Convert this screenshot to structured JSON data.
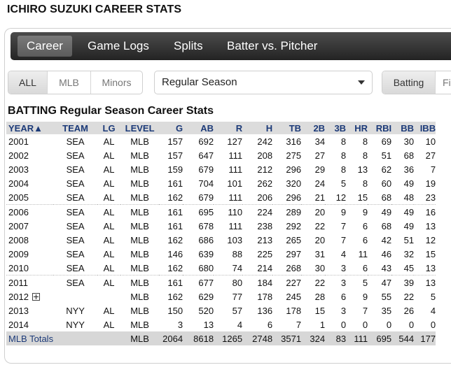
{
  "page": {
    "title": "ICHIRO SUZUKI CAREER STATS"
  },
  "nav": {
    "tabs": [
      {
        "label": "Career",
        "active": true
      },
      {
        "label": "Game Logs",
        "active": false
      },
      {
        "label": "Splits",
        "active": false
      },
      {
        "label": "Batter vs. Pitcher",
        "active": false
      }
    ]
  },
  "filters": {
    "league_options": [
      {
        "label": "ALL",
        "active": true
      },
      {
        "label": "MLB",
        "active": false
      },
      {
        "label": "Minors",
        "active": false
      }
    ],
    "season_type": "Regular Season",
    "stat_types": [
      {
        "label": "Batting",
        "active": true
      },
      {
        "label": "Fi",
        "active": false
      }
    ]
  },
  "section": {
    "title": "BATTING Regular Season Career Stats"
  },
  "table": {
    "columns": [
      "YEAR▲",
      "TEAM",
      "LG",
      "LEVEL",
      "G",
      "AB",
      "R",
      "H",
      "TB",
      "2B",
      "3B",
      "HR",
      "RBI",
      "BB",
      "IBB"
    ],
    "rows": [
      [
        "2001",
        "SEA",
        "AL",
        "MLB",
        "157",
        "692",
        "127",
        "242",
        "316",
        "34",
        "8",
        "8",
        "69",
        "30",
        "10"
      ],
      [
        "2002",
        "SEA",
        "AL",
        "MLB",
        "157",
        "647",
        "111",
        "208",
        "275",
        "27",
        "8",
        "8",
        "51",
        "68",
        "27"
      ],
      [
        "2003",
        "SEA",
        "AL",
        "MLB",
        "159",
        "679",
        "111",
        "212",
        "296",
        "29",
        "8",
        "13",
        "62",
        "36",
        "7"
      ],
      [
        "2004",
        "SEA",
        "AL",
        "MLB",
        "161",
        "704",
        "101",
        "262",
        "320",
        "24",
        "5",
        "8",
        "60",
        "49",
        "19"
      ],
      [
        "2005",
        "SEA",
        "AL",
        "MLB",
        "162",
        "679",
        "111",
        "206",
        "296",
        "21",
        "12",
        "15",
        "68",
        "48",
        "23"
      ],
      [
        "2006",
        "SEA",
        "AL",
        "MLB",
        "161",
        "695",
        "110",
        "224",
        "289",
        "20",
        "9",
        "9",
        "49",
        "49",
        "16"
      ],
      [
        "2007",
        "SEA",
        "AL",
        "MLB",
        "161",
        "678",
        "111",
        "238",
        "292",
        "22",
        "7",
        "6",
        "68",
        "49",
        "13"
      ],
      [
        "2008",
        "SEA",
        "AL",
        "MLB",
        "162",
        "686",
        "103",
        "213",
        "265",
        "20",
        "7",
        "6",
        "42",
        "51",
        "12"
      ],
      [
        "2009",
        "SEA",
        "AL",
        "MLB",
        "146",
        "639",
        "88",
        "225",
        "297",
        "31",
        "4",
        "11",
        "46",
        "32",
        "15"
      ],
      [
        "2010",
        "SEA",
        "AL",
        "MLB",
        "162",
        "680",
        "74",
        "214",
        "268",
        "30",
        "3",
        "6",
        "43",
        "45",
        "13"
      ],
      [
        "2011",
        "SEA",
        "AL",
        "MLB",
        "161",
        "677",
        "80",
        "184",
        "227",
        "22",
        "3",
        "5",
        "47",
        "39",
        "13"
      ],
      [
        "2012",
        "",
        "",
        "MLB",
        "162",
        "629",
        "77",
        "178",
        "245",
        "28",
        "6",
        "9",
        "55",
        "22",
        "5"
      ],
      [
        "2013",
        "NYY",
        "AL",
        "MLB",
        "150",
        "520",
        "57",
        "136",
        "178",
        "15",
        "3",
        "7",
        "35",
        "26",
        "4"
      ],
      [
        "2014",
        "NYY",
        "AL",
        "MLB",
        "3",
        "13",
        "4",
        "6",
        "7",
        "1",
        "0",
        "0",
        "0",
        "0",
        "0"
      ]
    ],
    "totals": [
      "MLB Totals",
      "",
      "",
      "MLB",
      "2064",
      "8618",
      "1265",
      "2748",
      "3571",
      "324",
      "83",
      "111",
      "695",
      "544",
      "177"
    ]
  },
  "icons": {
    "expand_row": "plus-box-icon",
    "dropdown": "caret-down-icon"
  }
}
